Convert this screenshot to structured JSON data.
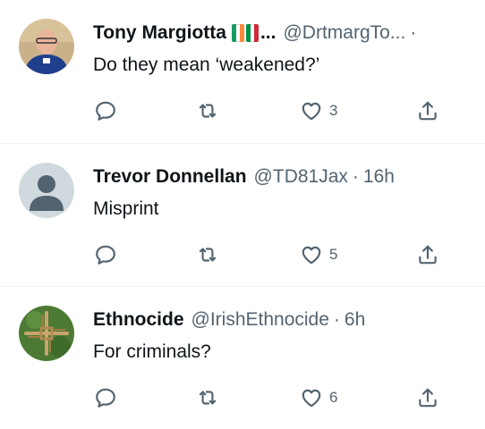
{
  "replies": [
    {
      "display_name": "Tony Margiotta",
      "name_suffix": "...",
      "handle": "@DrtmargTo...",
      "separator": "·",
      "time": "",
      "text": "Do they mean ‘weakened?’",
      "likes": "3",
      "flags": [
        "ireland-flag",
        "italy-flag"
      ]
    },
    {
      "display_name": "Trevor Donnellan",
      "handle": "@TD81Jax",
      "separator": "·",
      "time": "16h",
      "text": "Misprint",
      "likes": "5"
    },
    {
      "display_name": "Ethnocide",
      "handle": "@IrishEthnocide",
      "separator": "·",
      "time": "6h",
      "text": "For criminals?",
      "likes": "6"
    }
  ],
  "colors": {
    "text": "#0f1419",
    "secondary": "#536471",
    "divider": "#eff3f4",
    "ireland": [
      "#169b62",
      "#ffffff",
      "#ff883e"
    ],
    "italy": [
      "#009246",
      "#ffffff",
      "#ce2b37"
    ]
  },
  "icons": [
    "reply-icon",
    "repost-icon",
    "like-icon",
    "share-icon"
  ]
}
